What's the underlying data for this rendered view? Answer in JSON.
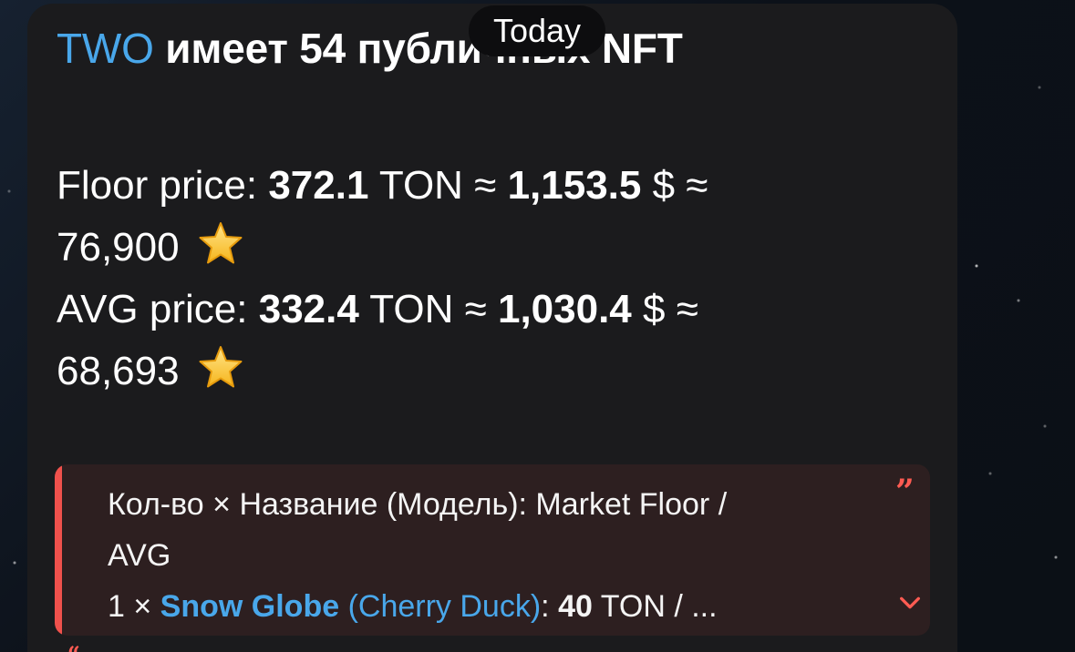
{
  "date_pill": "Today",
  "message": {
    "title_name": "TWO",
    "title_rest": "имеет 54 публичных NFT",
    "floor_label": "Floor price:",
    "floor_ton": "372.1",
    "floor_ton_unit": "TON ≈",
    "floor_usd": "1,153.5",
    "floor_usd_unit": "$ ≈",
    "floor_stars": "76,900",
    "avg_label": "AVG price:",
    "avg_ton": "332.4",
    "avg_ton_unit": "TON ≈",
    "avg_usd": "1,030.4",
    "avg_usd_unit": "$ ≈",
    "avg_stars": "68,693"
  },
  "quote": {
    "header_line_1": "Кол-во × Название (Модель): Market Floor /",
    "header_line_2": "AVG",
    "row_count": "1 ×",
    "row_name": "Snow Globe",
    "row_model": "(Cherry Duck)",
    "row_colon": ":",
    "row_value": "40",
    "row_tail": "TON / ...",
    "accent_color": "#f0514c",
    "quote_icon": "quote-icon",
    "expand_icon": "chevron-down-icon"
  },
  "colors": {
    "link_blue": "#49a7ea",
    "bubble_bg": "#1b1b1d",
    "quote_bg": "#2d1f20"
  }
}
